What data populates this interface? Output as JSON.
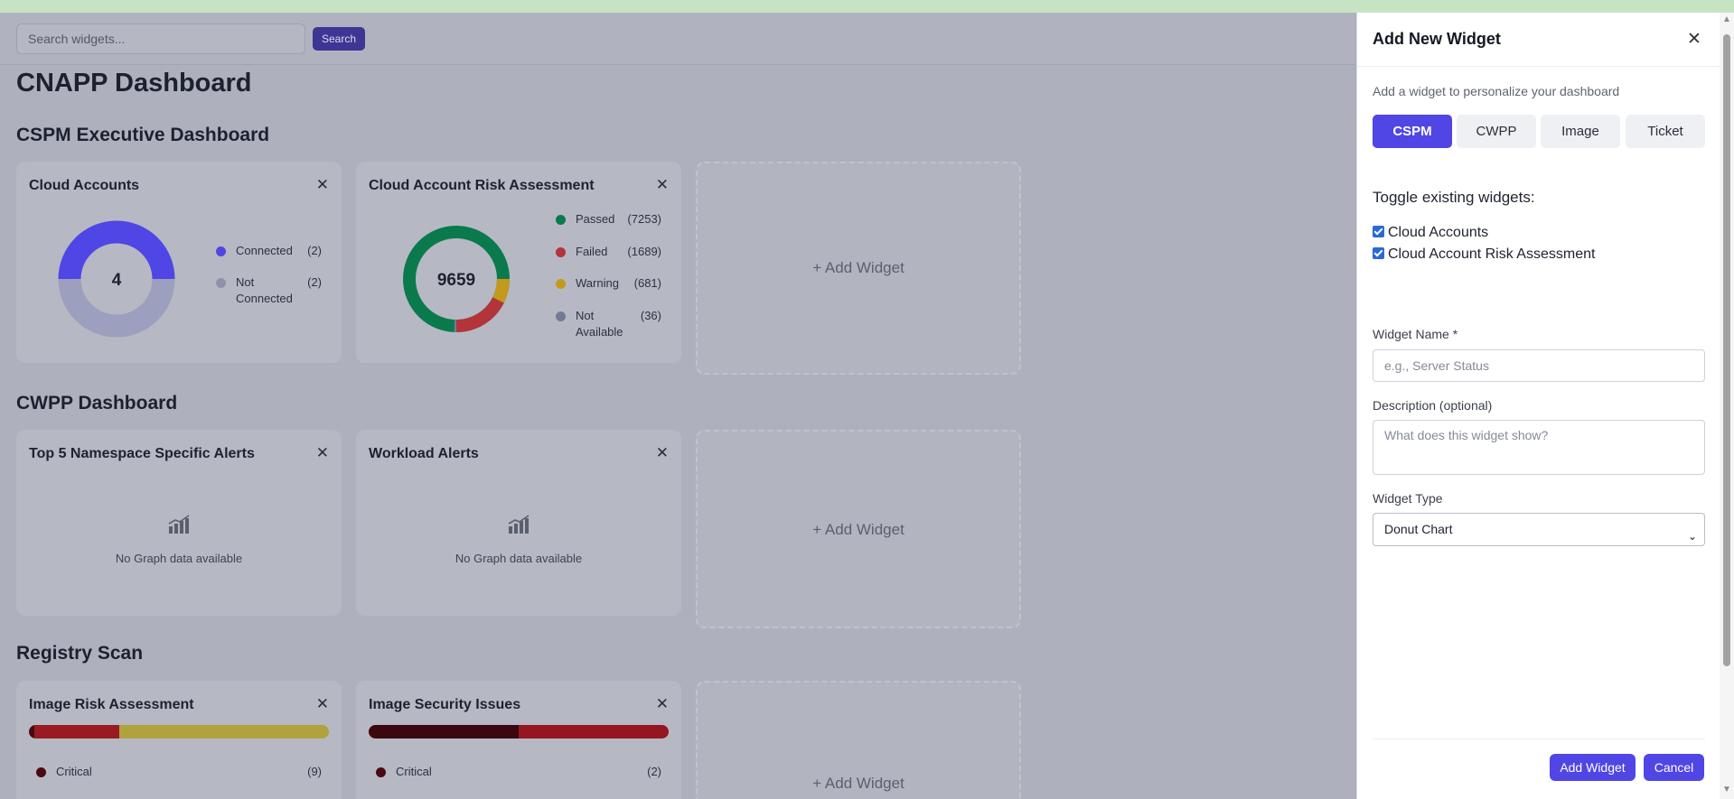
{
  "search": {
    "placeholder": "Search widgets...",
    "button": "Search"
  },
  "page_title": "CNAPP Dashboard",
  "sections": {
    "cspm": {
      "title": "CSPM Executive Dashboard",
      "cloud_accounts": {
        "title": "Cloud Accounts",
        "center": "4",
        "legend": [
          {
            "label": "Connected",
            "count": "(2)",
            "color": "#4f46e5"
          },
          {
            "label": "Not Connected",
            "count": "(2)",
            "color": "#8f92ae"
          }
        ]
      },
      "risk": {
        "title": "Cloud Account Risk Assessment",
        "center": "9659",
        "legend": [
          {
            "label": "Passed",
            "count": "(7253)",
            "color": "#0a7a4c"
          },
          {
            "label": "Failed",
            "count": "(1689)",
            "color": "#b3343b"
          },
          {
            "label": "Warning",
            "count": "(681)",
            "color": "#c49a1c"
          },
          {
            "label": "Not Available",
            "count": "(36)",
            "color": "#737a95"
          }
        ]
      },
      "add": "+ Add Widget"
    },
    "cwpp": {
      "title": "CWPP Dashboard",
      "namespace": {
        "title": "Top 5 Namespace Specific Alerts",
        "empty": "No Graph data available"
      },
      "workload": {
        "title": "Workload Alerts",
        "empty": "No Graph data available"
      },
      "add": "+ Add Widget"
    },
    "registry": {
      "title": "Registry Scan",
      "image_risk": {
        "title": "Image Risk Assessment",
        "bar": [
          {
            "value": 9,
            "color": "#4a0a12"
          },
          {
            "value": 150,
            "color": "#9a1a22"
          },
          {
            "value": 370,
            "color": "#b0a33e"
          }
        ],
        "legend": [
          {
            "label": "Critical",
            "count": "(9)",
            "color": "#4a0a12"
          }
        ]
      },
      "image_security": {
        "title": "Image Security Issues",
        "bar": [
          {
            "value": 2,
            "color": "#3c0810"
          },
          {
            "value": 2,
            "color": "#951620"
          }
        ],
        "legend": [
          {
            "label": "Critical",
            "count": "(2)",
            "color": "#4a0a12"
          }
        ]
      },
      "add": "+ Add Widget"
    }
  },
  "panel": {
    "title": "Add New Widget",
    "subtitle": "Add a widget to personalize your dashboard",
    "tabs": [
      "CSPM",
      "CWPP",
      "Image",
      "Ticket"
    ],
    "active_tab": "CSPM",
    "toggle_heading": "Toggle existing widgets:",
    "toggles": [
      {
        "label": "Cloud Accounts",
        "checked": true
      },
      {
        "label": "Cloud Account Risk Assessment",
        "checked": true
      }
    ],
    "name_label": "Widget Name *",
    "name_placeholder": "e.g., Server Status",
    "desc_label": "Description (optional)",
    "desc_placeholder": "What does this widget show?",
    "type_label": "Widget Type",
    "type_value": "Donut Chart",
    "add_button": "Add Widget",
    "cancel_button": "Cancel"
  },
  "colors": {
    "accent": "#4f46e5",
    "overlay": "#aeb1bd"
  }
}
